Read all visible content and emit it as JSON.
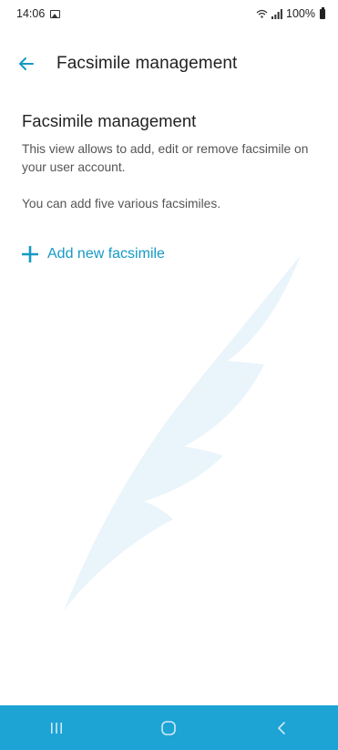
{
  "status_bar": {
    "time": "14:06",
    "battery": "100%",
    "icons": [
      "gallery-icon",
      "wifi-icon",
      "signal-icon",
      "battery-icon"
    ]
  },
  "app_bar": {
    "title": "Facsimile management",
    "back_icon": "arrow-left-icon"
  },
  "main": {
    "heading": "Facsimile management",
    "description": "This view allows to add, edit or remove facsimile on your user account.",
    "note": "You can add five various facsimiles.",
    "add_button_label": "Add new facsimile",
    "add_icon": "plus-icon"
  },
  "nav_bar": {
    "items": [
      "recent-apps-icon",
      "home-icon",
      "back-icon"
    ]
  },
  "colors": {
    "accent": "#1599c5",
    "nav_bar": "#1ea3d5",
    "watermark": "#eaf4fb",
    "text_primary": "#222222",
    "text_secondary": "#555555"
  }
}
